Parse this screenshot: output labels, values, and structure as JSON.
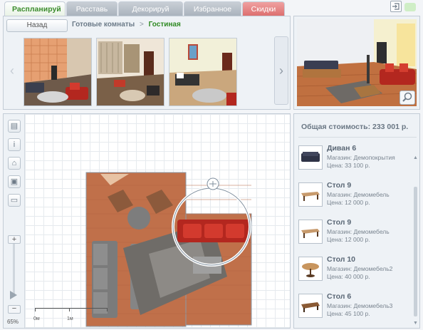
{
  "tabs": [
    {
      "label": "Распланируй",
      "state": "active"
    },
    {
      "label": "Расставь",
      "state": "inactive"
    },
    {
      "label": "Декорируй",
      "state": "inactive"
    },
    {
      "label": "Избранное",
      "state": "inactive"
    },
    {
      "label": "Скидки",
      "state": "highlight"
    }
  ],
  "gallery": {
    "back_label": "Назад",
    "breadcrumb": [
      "Готовые комнаты",
      "Гостиная"
    ],
    "separator": ">",
    "prev_icon": "chevron-left-icon",
    "next_icon": "chevron-right-icon",
    "thumbnails": [
      "room-thumbnail-1",
      "room-thumbnail-2",
      "room-thumbnail-3"
    ]
  },
  "preview": {
    "zoom_icon": "magnifier-icon"
  },
  "planner": {
    "tools": [
      "page-icon",
      "info-icon",
      "lamp-icon",
      "save-icon",
      "folder-icon"
    ],
    "zoom_in": "+",
    "zoom_out": "−",
    "zoom_level": "65%",
    "scale_labels": [
      "0м",
      "1м"
    ]
  },
  "sidebar": {
    "total": "Общая стоимость: 233 001 р.",
    "items": [
      {
        "name": "Диван 6",
        "shop": "Магазин: Демопокрытия",
        "price": "Цена: 33 100 р."
      },
      {
        "name": "Стол 9",
        "shop": "Магазин: Демомебель",
        "price": "Цена: 12 000 р."
      },
      {
        "name": "Стол 9",
        "shop": "Магазин: Демомебель",
        "price": "Цена: 12 000 р."
      },
      {
        "name": "Стол 10",
        "shop": "Магазин: Демомебель2",
        "price": "Цена: 40 000 р."
      },
      {
        "name": "Стол 6",
        "shop": "Магазин: Демомебель3",
        "price": "Цена: 45 100 р."
      }
    ]
  },
  "colors": {
    "accent_green": "#2f8a23",
    "highlight_red": "#dd6f6f",
    "floor": "#c0704a",
    "sofa_red": "#b7271f"
  }
}
